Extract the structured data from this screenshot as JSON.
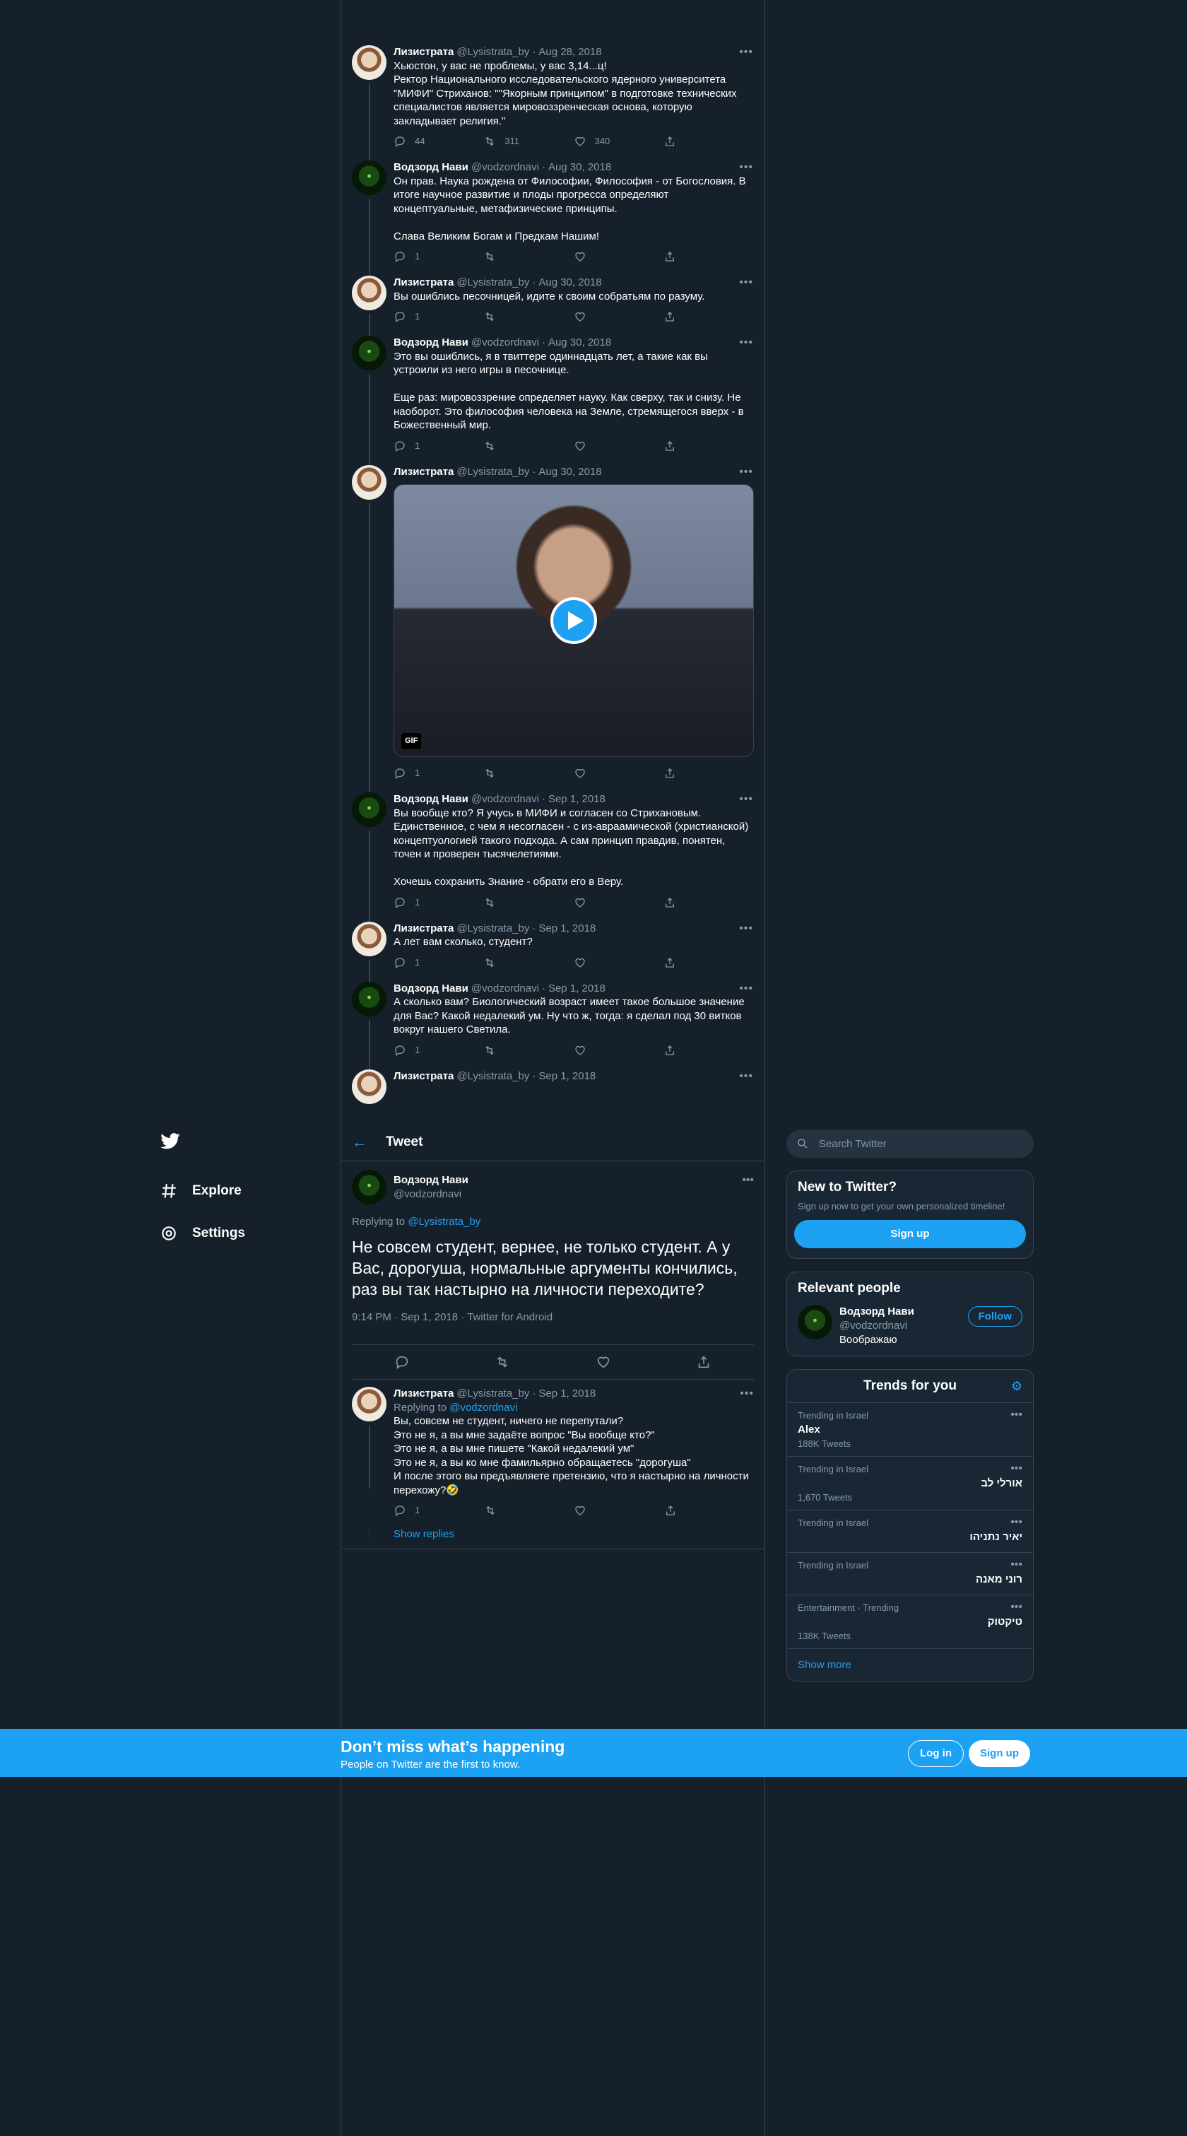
{
  "thread": [
    {
      "name": "Лизистрата",
      "handle": "@Lysistrata_by",
      "date": "Aug 28, 2018",
      "avatar": "liz",
      "text": "Хьюстон, у вас не проблемы, у вас 3,14...ц!\nРектор Национального исследовательского ядерного университета \"МИФИ\" Стриханов: \"\"Якорным принципом\" в подготовке технических специалистов является мировоззренческая основа, которую закладывает религия.\"",
      "reply": "44",
      "retweet": "311",
      "like": "340",
      "gif": false
    },
    {
      "name": "Водзорд Нави",
      "handle": "@vodzordnavi",
      "date": "Aug 30, 2018",
      "avatar": "vod",
      "text": "Он прав. Наука рождена от Философии, Философия - от Богословия. В итоге научное развитие и плоды прогресса определяют концептуальные, метафизические принципы.\n\nСлава Великим Богам и Предкам Нашим!",
      "reply": "1",
      "retweet": "",
      "like": "",
      "gif": false
    },
    {
      "name": "Лизистрата",
      "handle": "@Lysistrata_by",
      "date": "Aug 30, 2018",
      "avatar": "liz",
      "text": "Вы ошиблись песочницей, идите к своим собратьям по разуму.",
      "reply": "1",
      "retweet": "",
      "like": "",
      "gif": false
    },
    {
      "name": "Водзорд Нави",
      "handle": "@vodzordnavi",
      "date": "Aug 30, 2018",
      "avatar": "vod",
      "text": "Это вы ошиблись, я в твиттере одиннадцать лет, а такие как вы устроили из него игры в песочнице.\n\nЕще раз: мировоззрение определяет науку. Как сверху, так и снизу. Не наоборот. Это философия человека на Земле, стремящегося вверх - в Божественный мир.",
      "reply": "1",
      "retweet": "",
      "like": "",
      "gif": false
    },
    {
      "name": "Лизистрата",
      "handle": "@Lysistrata_by",
      "date": "Aug 30, 2018",
      "avatar": "liz",
      "text": "",
      "reply": "1",
      "retweet": "",
      "like": "",
      "gif": true
    },
    {
      "name": "Водзорд Нави",
      "handle": "@vodzordnavi",
      "date": "Sep 1, 2018",
      "avatar": "vod",
      "text": "Вы вообще кто? Я учусь в МИФИ и согласен со Стрихановым. Единственное, с чем я несогласен - с из-авраамической (христианской) концептуологией такого подхода. А сам принцип правдив, понятен, точен и проверен тысячелетиями.\n\nХочешь сохранить Знание - обрати его в Веру.",
      "reply": "1",
      "retweet": "",
      "like": "",
      "gif": false
    },
    {
      "name": "Лизистрата",
      "handle": "@Lysistrata_by",
      "date": "Sep 1, 2018",
      "avatar": "liz",
      "text": "А лет вам сколько, студент?",
      "reply": "1",
      "retweet": "",
      "like": "",
      "gif": false
    },
    {
      "name": "Водзорд Нави",
      "handle": "@vodzordnavi",
      "date": "Sep 1, 2018",
      "avatar": "vod",
      "text": "А сколько вам? Биологический возраст имеет такое большое значение для Вас? Какой недалекий ум. Ну что ж, тогда: я сделал под 30 витков вокруг нашего Светила.",
      "reply": "1",
      "retweet": "",
      "like": "",
      "gif": false
    },
    {
      "name": "Лизистрата",
      "handle": "@Lysistrata_by",
      "date": "Sep 1, 2018",
      "avatar": "liz",
      "text": "",
      "reply": "",
      "retweet": "",
      "like": "",
      "gif": false,
      "partial": true
    }
  ],
  "gif_label": "GIF",
  "nav": {
    "explore": "Explore",
    "settings": "Settings"
  },
  "header": {
    "title": "Tweet"
  },
  "focus": {
    "name": "Водзорд Нави",
    "handle": "@vodzordnavi",
    "replying_prefix": "Replying to ",
    "replying_to": "@Lysistrata_by",
    "text": "Не совсем студент, вернее, не только студент. А у Вас, дорогуша, нормальные аргументы кончились, раз вы так настырно на личности переходите?",
    "meta": "9:14 PM · Sep 1, 2018 · Twitter for Android"
  },
  "reply": {
    "name": "Лизистрата",
    "handle": "@Lysistrata_by",
    "date": "Sep 1, 2018",
    "replying_prefix": "Replying to ",
    "replying_to": "@vodzordnavi",
    "text": "Вы, совсем не студент, ничего не перепутали?\nЭто не я, а вы мне задаёте вопрос \"Вы вообще кто?\"\nЭто не я, а вы мне пишете \"Какой недалекий ум\"\nЭто не я, а вы ко мне фамильярно обращаетесь \"дорогуша\"\nИ после этого вы предъявляете претензию, что я настырно на личности перехожу?🤣",
    "reply_count": "1",
    "show_replies": "Show replies"
  },
  "search": {
    "placeholder": "Search Twitter"
  },
  "new_card": {
    "title": "New to Twitter?",
    "sub": "Sign up now to get your own personalized timeline!",
    "button": "Sign up"
  },
  "relevant": {
    "title": "Relevant people",
    "name": "Водзорд Нави",
    "handle": "@vodzordnavi",
    "bio": "Воображаю",
    "follow": "Follow"
  },
  "trends": {
    "title": "Trends for you",
    "items": [
      {
        "context": "Trending in Israel",
        "name": "Alex",
        "count": "188K Tweets",
        "rtl": false
      },
      {
        "context": "Trending in Israel",
        "name": "אורלי לב",
        "count": "1,670 Tweets",
        "rtl": true
      },
      {
        "context": "Trending in Israel",
        "name": "יאיר נתניהו",
        "count": "",
        "rtl": true
      },
      {
        "context": "Trending in Israel",
        "name": "רוני מאנה",
        "count": "",
        "rtl": true
      },
      {
        "context": "Entertainment · Trending",
        "name": "טיקטוק",
        "count": "138K Tweets",
        "rtl": true
      }
    ],
    "show_more": "Show more"
  },
  "banner": {
    "title": "Don’t miss what’s happening",
    "sub": "People on Twitter are the first to know.",
    "login": "Log in",
    "signup": "Sign up"
  },
  "colors": {
    "bg": "#15202b",
    "accent": "#1da1f2",
    "border": "#38444d",
    "muted": "#8899a6"
  }
}
